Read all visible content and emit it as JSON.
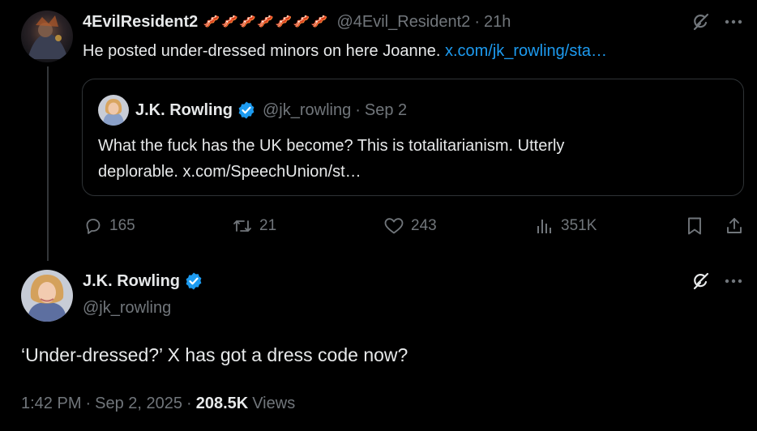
{
  "reply_tweet": {
    "display_name": "4EvilResident2",
    "name_emoji": "🥓🥓🥓🥓🥓🥓🥓",
    "handle": "@4Evil_Resident2",
    "separator": "·",
    "time": "21h",
    "text": "He posted under-dressed minors on here Joanne. ",
    "link": "x.com/jk_rowling/sta…",
    "quote": {
      "display_name": "J.K. Rowling",
      "handle": "@jk_rowling",
      "separator": "·",
      "date": "Sep 2",
      "text_line1": "What the fuck has the UK become? This is totalitarianism. Utterly",
      "text_line2": "deplorable. x.com/SpeechUnion/st…"
    },
    "stats": {
      "replies": "165",
      "reposts": "21",
      "likes": "243",
      "views": "351K"
    }
  },
  "main_tweet": {
    "display_name": "J.K. Rowling",
    "handle": "@jk_rowling",
    "text": "‘Under-dressed?’ X has got a dress code now?",
    "time": "1:42 PM",
    "sep1": "·",
    "date": "Sep 2, 2025",
    "sep2": "·",
    "views_count": "208.5K",
    "views_label": "Views"
  },
  "icons": {
    "grok": "grok-icon",
    "more": "more-icon",
    "reply": "reply-icon",
    "repost": "repost-icon",
    "like": "like-icon",
    "views": "views-icon",
    "bookmark": "bookmark-icon",
    "share": "share-icon",
    "verified": "verified-badge-icon"
  },
  "colors": {
    "background": "#000000",
    "text": "#e7e9ea",
    "muted": "#71767b",
    "link": "#1d9bf0",
    "verified": "#1d9bf0",
    "border": "#2f3336"
  }
}
